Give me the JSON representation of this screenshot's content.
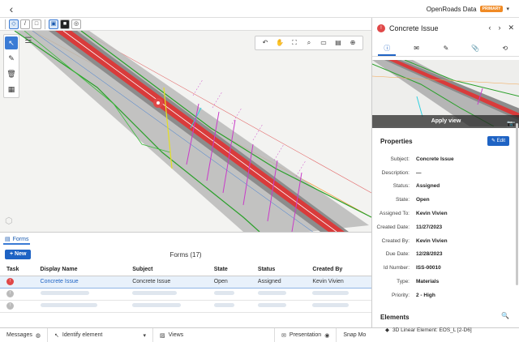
{
  "project": {
    "name": "OpenRoads Data",
    "badge": "PRIMARY"
  },
  "icons": {
    "back": "‹",
    "chevron_down": "▾",
    "select": "↖",
    "pencil": "✎",
    "trash": "🗑",
    "ruler": "▦",
    "menu": "☰",
    "cube": "⬡",
    "info": "ⓘ",
    "comment": "✉",
    "edit": "✎",
    "attach": "📎",
    "history": "⟲",
    "prev": "‹",
    "next": "›",
    "close": "✕",
    "camera": "📷",
    "search": "🔍",
    "diamond": "◆",
    "plus": "+"
  },
  "view_toolbar": {
    "buttons": [
      "◇",
      "/",
      "□",
      "▣",
      "■",
      "◎"
    ]
  },
  "nav_tools": [
    "↶",
    "✋",
    "⛶",
    "⌕",
    "▭",
    "▤",
    "⊕"
  ],
  "forms": {
    "tab_label": "Forms",
    "new_label": "New",
    "title": "Forms (17)",
    "columns": [
      "Task",
      "Display Name",
      "Subject",
      "State",
      "Status",
      "Created By"
    ],
    "rows": [
      {
        "display_name": "Concrete Issue",
        "subject": "Concrete Issue",
        "state": "Open",
        "status": "Assigned",
        "created_by": "Kevin Vivien"
      }
    ]
  },
  "statusbar": {
    "messages": "Messages",
    "identify": "Identify element",
    "views": "Views",
    "presentation": "Presentation",
    "snap": "Snap Mo"
  },
  "issue": {
    "title": "Concrete Issue",
    "apply_view": "Apply view",
    "properties_title": "Properties",
    "edit_label": "Edit",
    "properties": [
      {
        "label": "Subject:",
        "value": "Concrete Issue"
      },
      {
        "label": "Description:",
        "value": "—"
      },
      {
        "label": "Status:",
        "value": "Assigned"
      },
      {
        "label": "State:",
        "value": "Open"
      },
      {
        "label": "Assigned To:",
        "value": "Kevin Vivien"
      },
      {
        "label": "Created Date:",
        "value": "11/27/2023"
      },
      {
        "label": "Created By:",
        "value": "Kevin Vivien"
      },
      {
        "label": "Due Date:",
        "value": "12/28/2023"
      },
      {
        "label": "Id Number:",
        "value": "ISS-00010"
      },
      {
        "label": "Type:",
        "value": "Materials"
      },
      {
        "label": "Priority:",
        "value": "2 - High"
      }
    ],
    "elements_title": "Elements",
    "elements": [
      "3D Linear Element: EOS_L [2-D6]"
    ]
  },
  "colors": {
    "accent": "#1e63c4",
    "issue_red": "#e04848",
    "badge_orange": "#f08a24"
  }
}
